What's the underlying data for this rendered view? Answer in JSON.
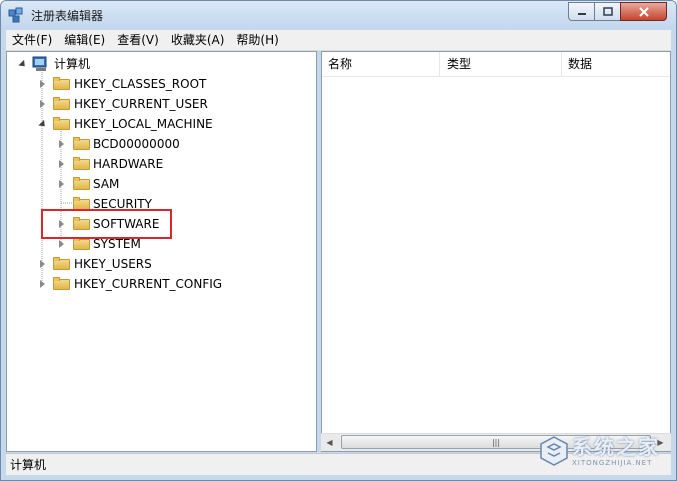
{
  "window": {
    "title": "注册表编辑器"
  },
  "menu": [
    "文件(F)",
    "编辑(E)",
    "查看(V)",
    "收藏夹(A)",
    "帮助(H)"
  ],
  "tree": {
    "root": "计算机",
    "hives": [
      {
        "label": "HKEY_CLASSES_ROOT",
        "expanded": false
      },
      {
        "label": "HKEY_CURRENT_USER",
        "expanded": false
      },
      {
        "label": "HKEY_LOCAL_MACHINE",
        "expanded": true
      },
      {
        "label": "HKEY_USERS",
        "expanded": false
      },
      {
        "label": "HKEY_CURRENT_CONFIG",
        "expanded": false
      }
    ],
    "hklm_children": [
      {
        "label": "BCD00000000",
        "expandable": true
      },
      {
        "label": "HARDWARE",
        "expandable": true
      },
      {
        "label": "SAM",
        "expandable": true
      },
      {
        "label": "SECURITY",
        "expandable": false
      },
      {
        "label": "SOFTWARE",
        "expandable": true
      },
      {
        "label": "SYSTEM",
        "expandable": true
      }
    ],
    "highlighted": "SOFTWARE"
  },
  "list": {
    "columns": [
      "名称",
      "类型",
      "数据"
    ]
  },
  "status": {
    "text": "计算机"
  },
  "watermark": {
    "text": "系统之家",
    "sub": "XITONGZHIJIA.NET"
  },
  "colors": {
    "highlight": "#d9272e",
    "folder": "#e2b54a",
    "titlebar": "#c2d6ee"
  }
}
